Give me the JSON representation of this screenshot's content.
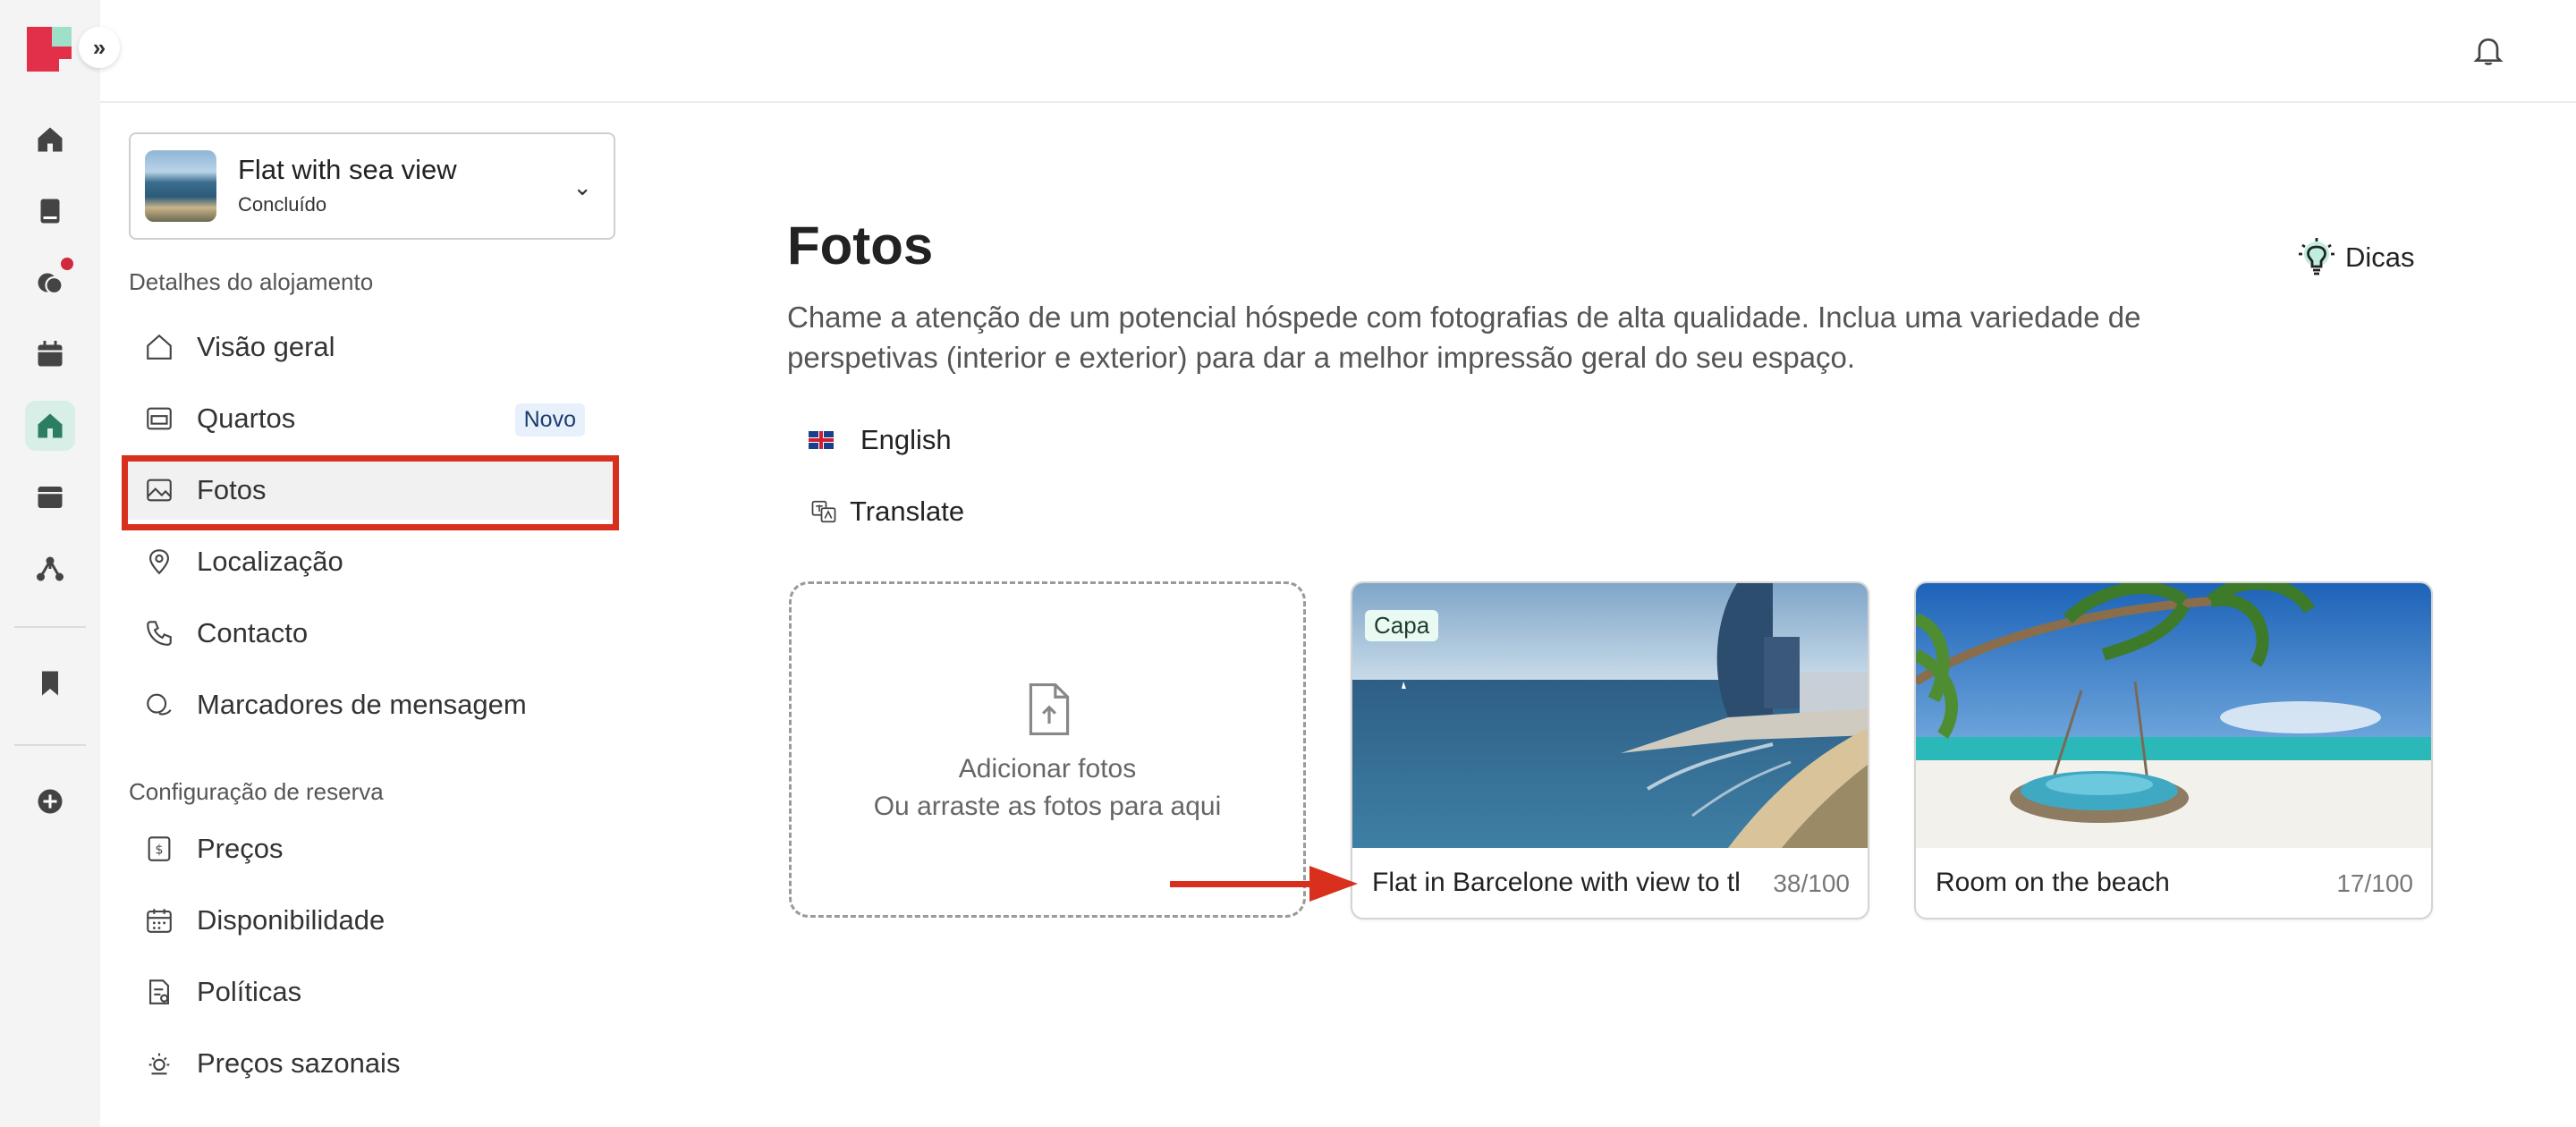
{
  "sidebar": {
    "property": {
      "name": "Flat with sea view",
      "status": "Concluído"
    },
    "sections": [
      {
        "heading": "Detalhes do alojamento"
      },
      {
        "heading": "Configuração de reserva"
      }
    ],
    "items": [
      {
        "label": "Visão geral",
        "icon": "house-icon"
      },
      {
        "label": "Quartos",
        "icon": "bed-icon",
        "badge": "Novo"
      },
      {
        "label": "Fotos",
        "icon": "image-icon",
        "active": true
      },
      {
        "label": "Localização",
        "icon": "map-pin-icon"
      },
      {
        "label": "Contacto",
        "icon": "phone-icon"
      },
      {
        "label": "Marcadores de mensagem",
        "icon": "chat-bubbles-icon"
      },
      {
        "label": "Preços",
        "icon": "price-tag-icon"
      },
      {
        "label": "Disponibilidade",
        "icon": "calendar-icon"
      },
      {
        "label": "Políticas",
        "icon": "policy-document-icon"
      },
      {
        "label": "Preços sazonais",
        "icon": "sun-icon"
      }
    ]
  },
  "main": {
    "title": "Fotos",
    "description": "Chame a atenção de um potencial hóspede com fotografias de alta qualidade. Inclua uma variedade de perspetivas (interior e exterior) para dar a melhor impressão geral do seu espaço.",
    "tips_label": "Dicas",
    "language": "English",
    "translate_label": "Translate",
    "upload": {
      "line1": "Adicionar fotos",
      "line2": "Ou arraste as fotos para aqui"
    },
    "photos": [
      {
        "caption": "Flat in Barcelone with view to the sea",
        "count": "38/100",
        "badge": "Capa"
      },
      {
        "caption": "Room on the beach",
        "count": "17/100"
      }
    ]
  },
  "colors": {
    "accent": "#e2304a",
    "highlight": "#d8301c",
    "active_rail": "#d7efe6"
  }
}
